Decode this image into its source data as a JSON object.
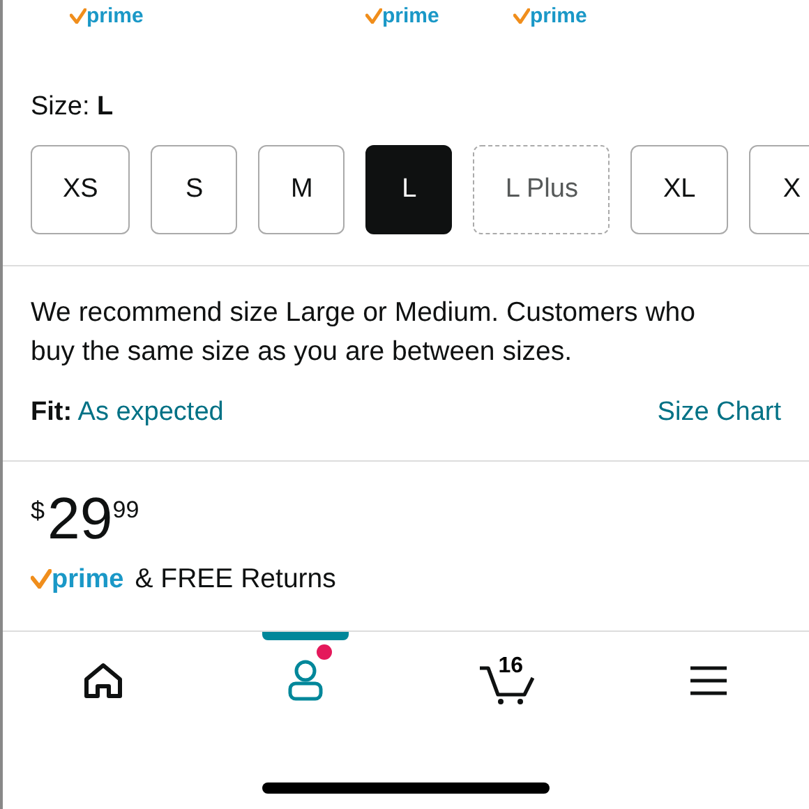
{
  "offers": [
    {
      "prime": true,
      "label": "prime"
    },
    {
      "prime": false
    },
    {
      "prime": true,
      "label": "prime"
    },
    {
      "prime": true,
      "label": "prime"
    },
    {
      "prime": false
    }
  ],
  "size": {
    "label": "Size:",
    "value": "L",
    "options": [
      {
        "label": "XS",
        "selected": false,
        "available": true
      },
      {
        "label": "S",
        "selected": false,
        "available": true
      },
      {
        "label": "M",
        "selected": false,
        "available": true
      },
      {
        "label": "L",
        "selected": true,
        "available": true
      },
      {
        "label": "L Plus",
        "selected": false,
        "available": false
      },
      {
        "label": "XL",
        "selected": false,
        "available": true
      },
      {
        "label": "X",
        "selected": false,
        "available": true
      }
    ]
  },
  "recommendation": "We recommend size Large or Medium. Customers who buy the same size as you are between sizes.",
  "fit": {
    "label": "Fit:",
    "value": "As expected",
    "link": "Size Chart"
  },
  "price": {
    "currency": "$",
    "whole": "29",
    "fraction": "99"
  },
  "delivery": {
    "prime": "prime",
    "text": "& FREE Returns"
  },
  "nav": [
    {
      "kind": "home",
      "selected": false
    },
    {
      "kind": "account",
      "selected": true,
      "notification": true
    },
    {
      "kind": "cart",
      "selected": false,
      "count": "16"
    },
    {
      "kind": "menu",
      "selected": false
    }
  ]
}
